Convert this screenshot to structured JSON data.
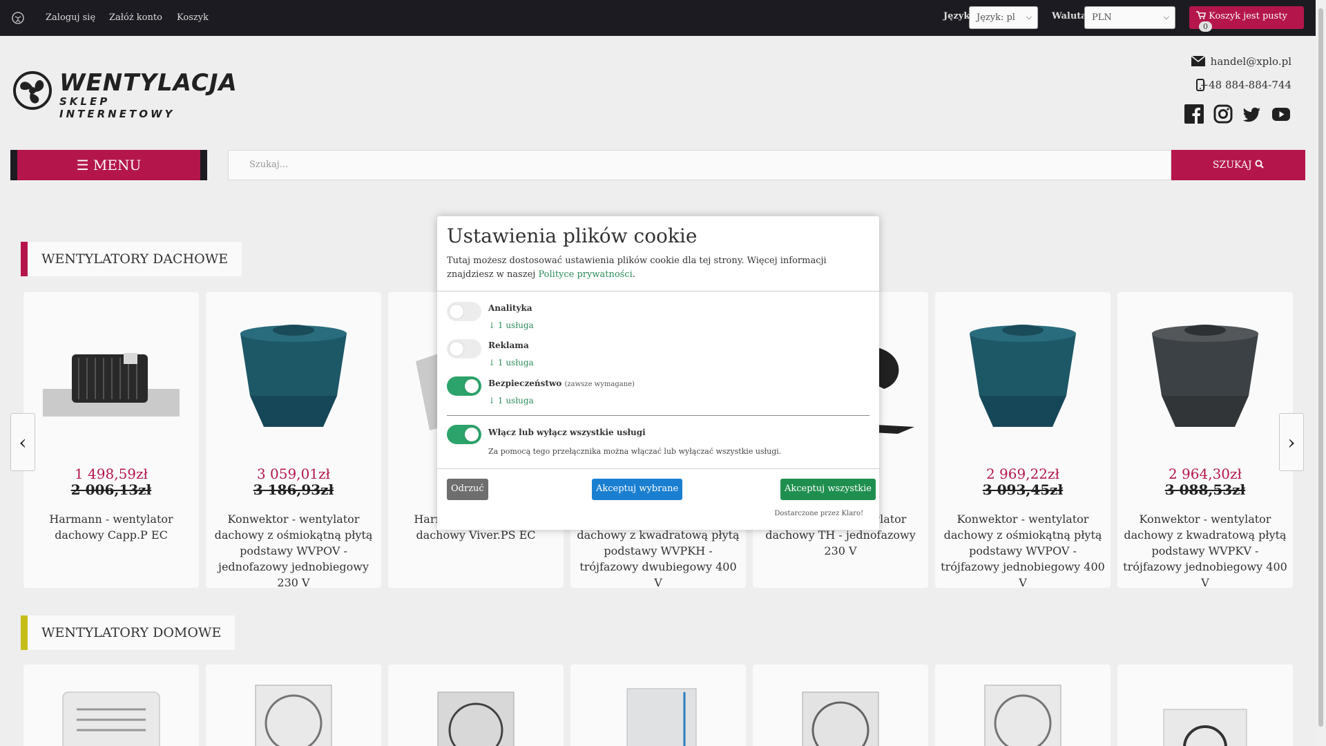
{
  "topbar": {
    "login": "Zaloguj się",
    "register": "Załóż konto",
    "cart": "Koszyk",
    "language_label": "Język",
    "language_value": "Język: pl",
    "currency_label": "Waluta",
    "currency_value": "PLN",
    "cart_button": "Koszyk jest pusty",
    "cart_count": "0"
  },
  "header": {
    "logo_line1": "WENTYLACJA",
    "logo_line2": "SKLEP INTERNETOWY",
    "email": "handel@xplo.pl",
    "phone": "+48 884-884-744",
    "social": [
      "facebook-icon",
      "instagram-icon",
      "twitter-icon",
      "youtube-icon"
    ]
  },
  "nav": {
    "menu_label": "MENU",
    "search_placeholder": "Szukaj...",
    "search_button": "SZUKAJ"
  },
  "sections": [
    {
      "title": "WENTYLATORY DACHOWE",
      "accent": "#b8174e",
      "products": [
        {
          "price": "1 498,59zł",
          "old_price": "2 006,13zł",
          "name": "Harmann - wentylator dachowy Capp.P EC"
        },
        {
          "price": "3 059,01zł",
          "old_price": "3 186,93zł",
          "name": "Konwektor - wentylator dachowy z ośmiokątną płytą podstawy WVPOV - jednofazowy jednobiegowy 230 V"
        },
        {
          "price": "",
          "old_price": "",
          "name": "Harmann - wentylator dachowy Viver.PS EC"
        },
        {
          "price": "",
          "old_price": "",
          "name": "Konwektor - wentylator dachowy z kwadratową płytą podstawy WVPKH - trójfazowy dwubiegowy 400 V"
        },
        {
          "price": "",
          "old_price": "",
          "name": "Konwektor - wentylator dachowy TH - jednofazowy 230 V"
        },
        {
          "price": "2 969,22zł",
          "old_price": "3 093,45zł",
          "name": "Konwektor - wentylator dachowy z ośmiokątną płytą podstawy WVPOV - trójfazowy jednobiegowy 400 V"
        },
        {
          "price": "2 964,30zł",
          "old_price": "3 088,53zł",
          "name": "Konwektor - wentylator dachowy z kwadratową płytą podstawy WVPKV - trójfazowy jednobiegowy 400 V"
        }
      ]
    },
    {
      "title": "WENTYLATORY DOMOWE",
      "accent": "#c9c21a"
    }
  ],
  "cookie_modal": {
    "title": "Ustawienia plików cookie",
    "intro": "Tutaj możesz dostosować ustawienia plików cookie dla tej strony. Więcej informacji znajdziesz w naszej",
    "privacy_link": "Polityce prywatności",
    "purposes": [
      {
        "name": "Analityka",
        "required": "",
        "services": "↓ 1 usługa",
        "enabled": false
      },
      {
        "name": "Reklama",
        "required": "",
        "services": "↓ 1 usługa",
        "enabled": false
      },
      {
        "name": "Bezpieczeństwo",
        "required": "(zawsze wymagane)",
        "services": "↓ 1 usługa",
        "enabled": true
      }
    ],
    "toggle_all_label": "Włącz lub wyłącz wszystkie usługi",
    "toggle_all_desc": "Za pomocą tego przełącznika można włączać lub wyłączać wszystkie usługi.",
    "decline": "Odrzuć",
    "accept_selected": "Akceptuj wybrane",
    "accept_all": "Akceptuj wszystkie",
    "powered_by": "Dostarczone przez Klaro!"
  },
  "colors": {
    "brand": "#b8174e",
    "dark": "#1c1c22",
    "accept_selected": "#1a7fd0",
    "accept_all": "#1f8f4f",
    "decline": "#6e6e6e",
    "toggle_on": "#2ca36a"
  }
}
